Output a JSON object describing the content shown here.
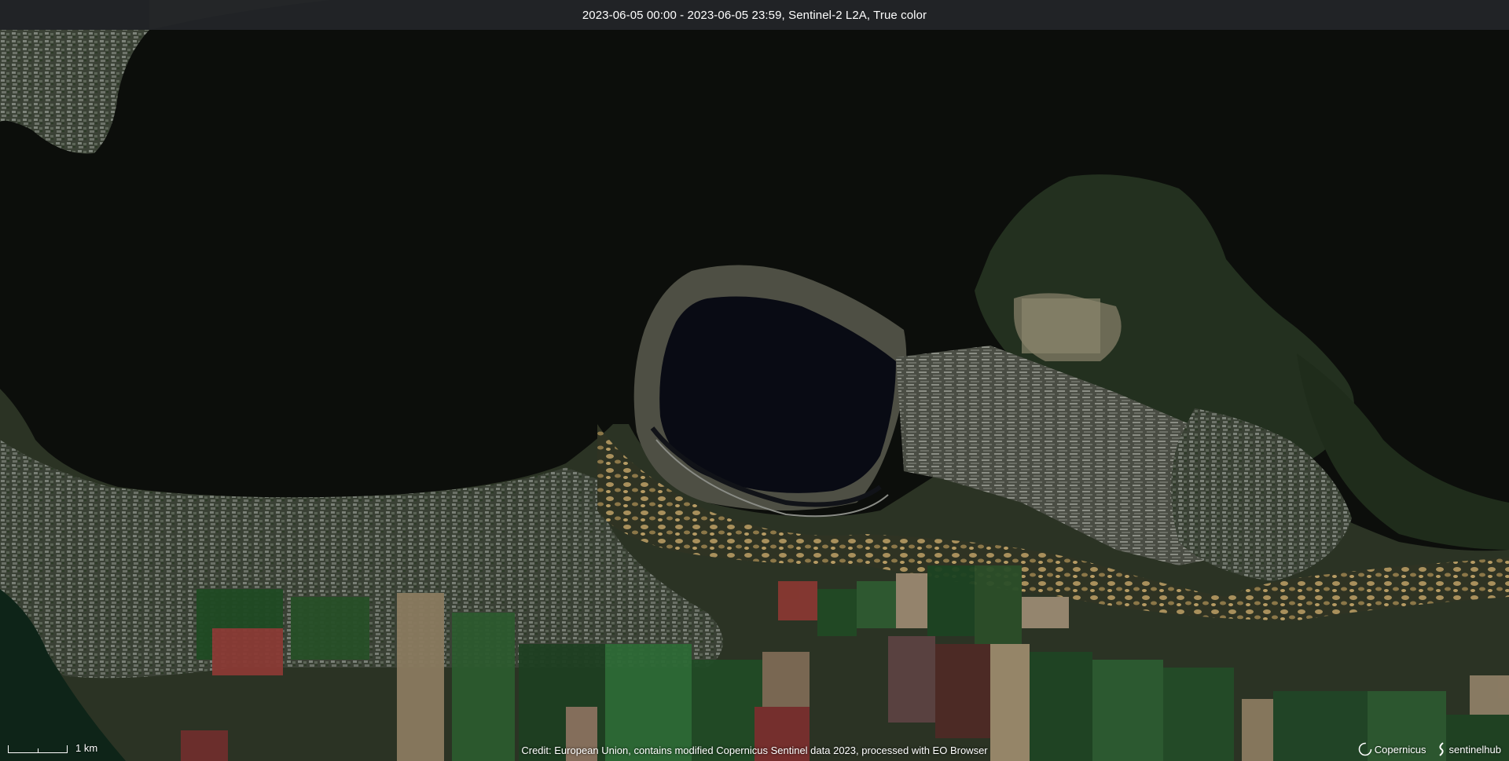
{
  "header": {
    "title": "2023-06-05 00:00 - 2023-06-05 23:59, Sentinel-2 L2A, True color"
  },
  "scale": {
    "label": "1 km"
  },
  "footer": {
    "credit": "Credit: European Union, contains modified Copernicus Sentinel data 2023, processed with EO Browser"
  },
  "logos": {
    "copernicus": "Copernicus",
    "sentinelhub": "sentinelhub"
  },
  "colors": {
    "water": "#0c0e0b",
    "title_bar": "#26282c",
    "vegetation": "#2f4a24",
    "fields_green": "#2a5a2a",
    "sand": "#b89a62"
  }
}
